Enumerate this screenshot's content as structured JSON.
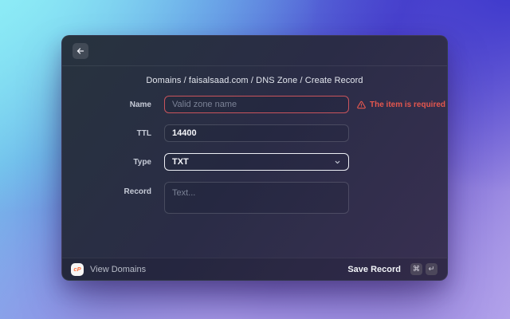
{
  "breadcrumb": "Domains / faisalsaad.com / DNS Zone / Create Record",
  "form": {
    "name": {
      "label": "Name",
      "placeholder": "Valid zone name",
      "error": "The item is required"
    },
    "ttl": {
      "label": "TTL",
      "value": "14400"
    },
    "type": {
      "label": "Type",
      "value": "TXT"
    },
    "record": {
      "label": "Record",
      "placeholder": "Text..."
    }
  },
  "footer": {
    "logo_text": "cP",
    "view_domains": "View Domains",
    "save_record": "Save Record",
    "keys": [
      "⌘",
      "↵"
    ]
  },
  "icons": {
    "back": "arrow-left",
    "name_error": "alert-triangle",
    "type_dropdown": "chevron-down",
    "shortcut_1": "command-key",
    "shortcut_2": "return-key",
    "logo": "cpanel-logo"
  },
  "colors": {
    "error": "#e4574e",
    "error_border": "#c9545c",
    "focused_border": "#eceef4",
    "logo_orange": "#ff6c37",
    "modal_dark": "#2a2c46",
    "bg_top_left": "#85e6f2",
    "bg_top_right": "#4340cc",
    "bg_bottom": "#b2a2ea"
  }
}
